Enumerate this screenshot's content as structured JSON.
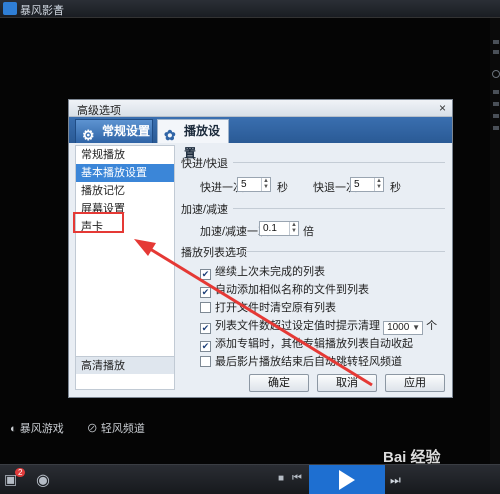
{
  "app": {
    "title": "暴风影音"
  },
  "bottom_links": {
    "game": "暴风游戏",
    "channel": "轻风频道"
  },
  "playbar": {
    "badge_count": "2"
  },
  "dialog": {
    "title": "高级选项",
    "close": "×",
    "tabs": [
      {
        "label": "常规设置",
        "active": true
      },
      {
        "label": "播放设置",
        "active": false
      }
    ],
    "sidebar": {
      "items": [
        {
          "label": "常规播放",
          "active": false
        },
        {
          "label": "基本播放设置",
          "active": true
        },
        {
          "label": "播放记忆",
          "active": false
        },
        {
          "label": "屏幕设置",
          "active": false
        },
        {
          "label": "声卡",
          "active": false
        }
      ],
      "footer": "高清播放"
    },
    "sections": {
      "seek": {
        "title": "快进/快退",
        "forward_label": "快进一次",
        "forward_value": "5",
        "forward_unit": "秒",
        "backward_label": "快退一次",
        "backward_value": "5",
        "backward_unit": "秒"
      },
      "speed": {
        "title": "加速/减速",
        "label": "加速/减速一次",
        "value": "0.1",
        "unit": "倍"
      },
      "playlist": {
        "title": "播放列表选项",
        "options": [
          {
            "label": "继续上次未完成的列表",
            "checked": true
          },
          {
            "label": "自动添加相似名称的文件到列表",
            "checked": true
          },
          {
            "label": "打开文件时清空原有列表",
            "checked": false
          },
          {
            "label_before": "列表文件数超过设定值时提示清理",
            "select_value": "1000",
            "label_after": "个",
            "checked": true
          },
          {
            "label": "添加专辑时，其他专辑播放列表自动收起",
            "checked": true
          },
          {
            "label": "最后影片播放结束后自动跳转轻风频道",
            "checked": false
          }
        ]
      }
    },
    "buttons": {
      "ok": "确定",
      "cancel": "取消",
      "apply": "应用"
    }
  },
  "watermark": {
    "text": "Bai 经验"
  },
  "colors": {
    "annotation": "#e53935",
    "accent": "#3b86d8",
    "play": "#1e6fd1"
  }
}
